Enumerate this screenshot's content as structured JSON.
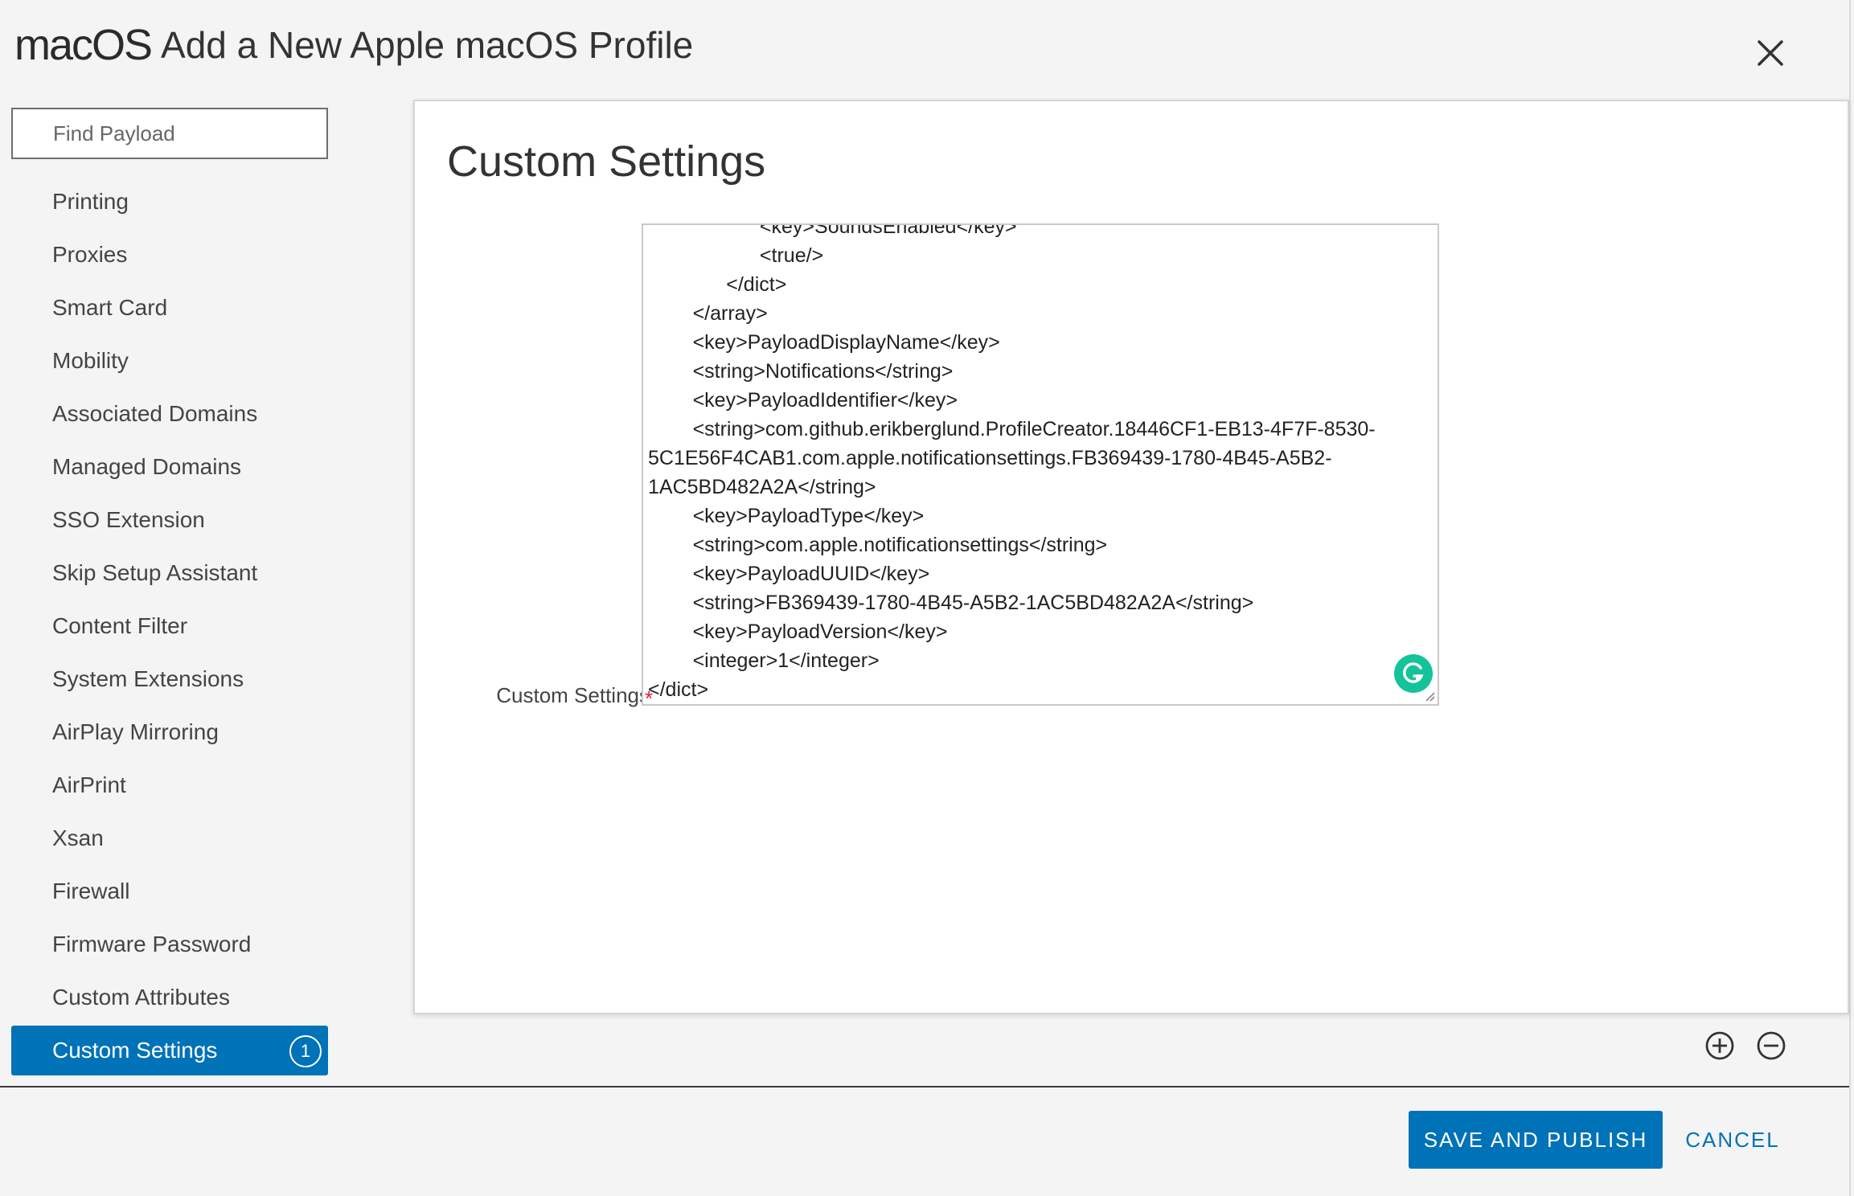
{
  "header": {
    "os_label": "macOS",
    "title": "Add a New Apple macOS Profile"
  },
  "sidebar": {
    "search_placeholder": "Find Payload",
    "items": [
      {
        "label": "Printing"
      },
      {
        "label": "Proxies"
      },
      {
        "label": "Smart Card"
      },
      {
        "label": "Mobility"
      },
      {
        "label": "Associated Domains"
      },
      {
        "label": "Managed Domains"
      },
      {
        "label": "SSO Extension"
      },
      {
        "label": "Skip Setup Assistant"
      },
      {
        "label": "Content Filter"
      },
      {
        "label": "System Extensions"
      },
      {
        "label": "AirPlay Mirroring"
      },
      {
        "label": "AirPrint"
      },
      {
        "label": "Xsan"
      },
      {
        "label": "Firewall"
      },
      {
        "label": "Firmware Password"
      },
      {
        "label": "Custom Attributes"
      },
      {
        "label": "Custom Settings",
        "active": true,
        "badge": "1"
      }
    ]
  },
  "main": {
    "title": "Custom Settings",
    "field_label": "Custom Settings",
    "required_marker": "*",
    "code_lines": [
      "                    <key>SoundsEnabled</key>",
      "                    <true/>",
      "              </dict>",
      "        </array>",
      "        <key>PayloadDisplayName</key>",
      "        <string>Notifications</string>",
      "        <key>PayloadIdentifier</key>",
      "        <string>com.github.erikberglund.ProfileCreator.18446CF1-EB13-4F7F-8530-",
      "5C1E56F4CAB1.com.apple.notificationsettings.FB369439-1780-4B45-A5B2-",
      "1AC5BD482A2A</string>",
      "        <key>PayloadType</key>",
      "        <string>com.apple.notificationsettings</string>",
      "        <key>PayloadUUID</key>",
      "        <string>FB369439-1780-4B45-A5B2-1AC5BD482A2A</string>",
      "        <key>PayloadVersion</key>",
      "        <integer>1</integer>",
      "</dict>"
    ]
  },
  "footer": {
    "save_label": "SAVE AND PUBLISH",
    "cancel_label": "CANCEL"
  },
  "colors": {
    "accent": "#0072b8",
    "required": "#d9232e",
    "grammarly": "#15c39a"
  },
  "icons": {
    "close": "close-icon",
    "add": "plus-circle-icon",
    "remove": "minus-circle-icon",
    "grammarly": "grammarly-icon"
  }
}
